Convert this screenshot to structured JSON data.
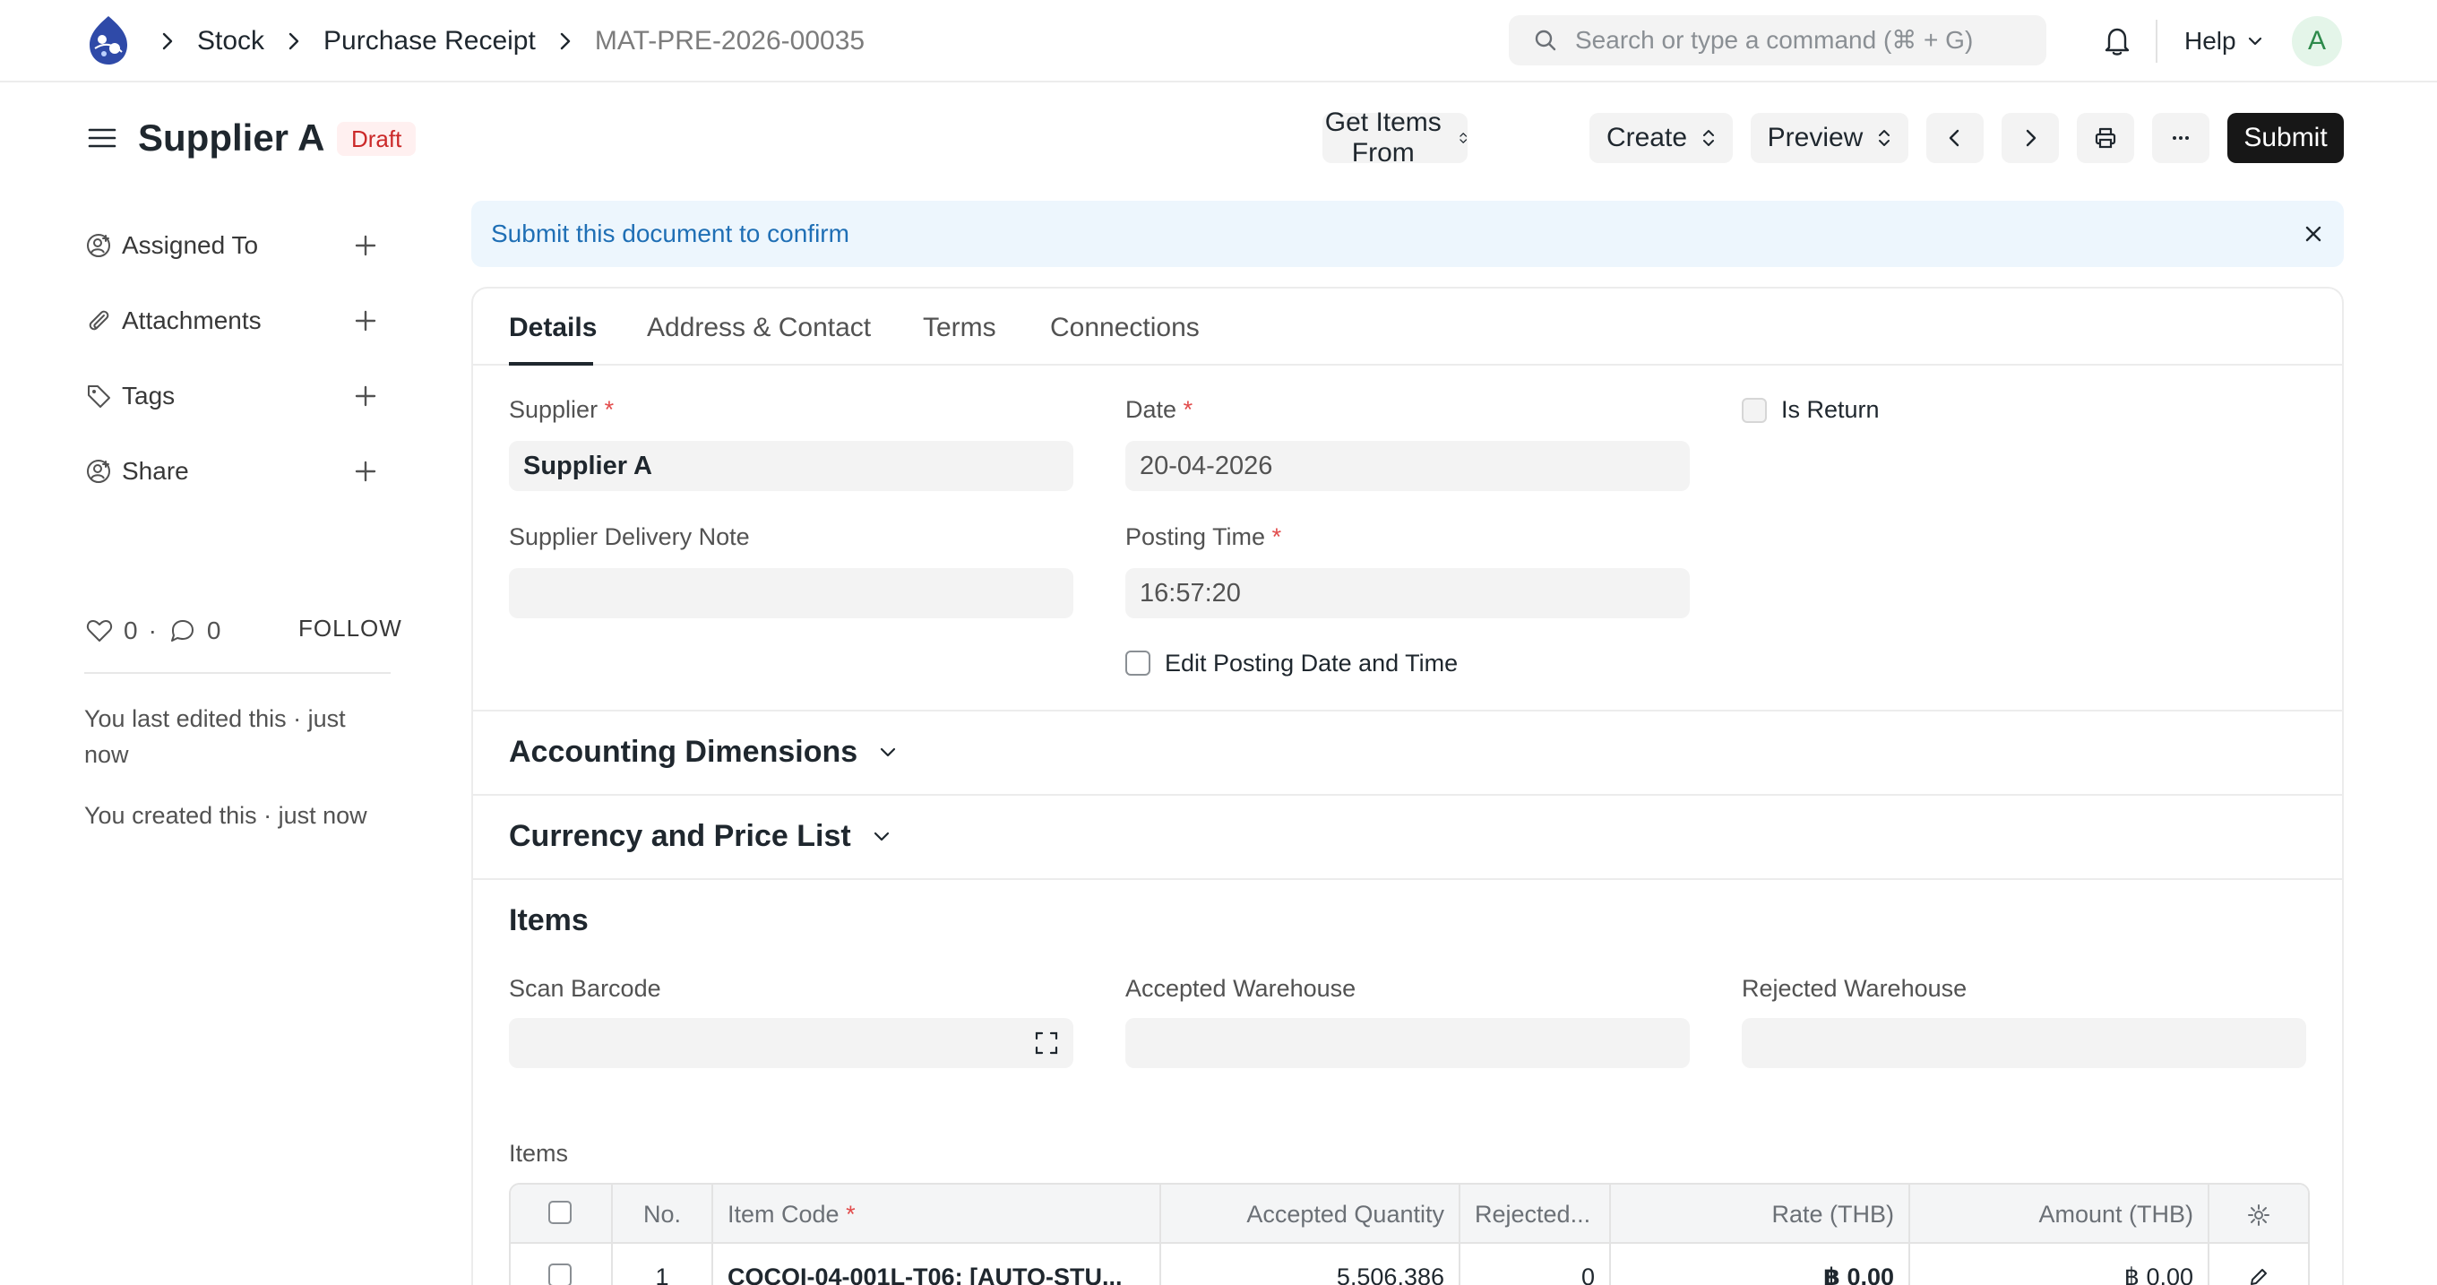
{
  "navbar": {
    "breadcrumbs": [
      "Stock",
      "Purchase Receipt",
      "MAT-PRE-2026-00035"
    ],
    "search_placeholder": "Search or type a command (⌘ + G)",
    "help_label": "Help",
    "avatar_initial": "A"
  },
  "header": {
    "title": "Supplier A",
    "status": "Draft",
    "buttons": {
      "get_items_from": "Get Items From",
      "create": "Create",
      "preview": "Preview",
      "submit": "Submit"
    }
  },
  "sidebar": {
    "items": [
      {
        "label": "Assigned To",
        "icon": "assign-user-icon"
      },
      {
        "label": "Attachments",
        "icon": "paperclip-icon"
      },
      {
        "label": "Tags",
        "icon": "tag-icon"
      },
      {
        "label": "Share",
        "icon": "share-user-icon"
      }
    ],
    "likes": "0",
    "comments": "0",
    "follow": "FOLLOW",
    "activity": [
      "You last edited this · just now",
      "You created this · just now"
    ]
  },
  "alert": {
    "message": "Submit this document to confirm"
  },
  "tabs": [
    "Details",
    "Address & Contact",
    "Terms",
    "Connections"
  ],
  "form": {
    "supplier_label": "Supplier",
    "supplier_value": "Supplier A",
    "delivery_note_label": "Supplier Delivery Note",
    "delivery_note_value": "",
    "date_label": "Date",
    "date_value": "20-04-2026",
    "posting_time_label": "Posting Time",
    "posting_time_value": "16:57:20",
    "edit_posting_label": "Edit Posting Date and Time",
    "is_return_label": "Is Return"
  },
  "sections": {
    "accounting": "Accounting Dimensions",
    "currency": "Currency and Price List",
    "items": "Items"
  },
  "items_section": {
    "scan_barcode_label": "Scan Barcode",
    "accepted_wh_label": "Accepted Warehouse",
    "rejected_wh_label": "Rejected Warehouse",
    "table_label": "Items"
  },
  "items_table": {
    "columns": [
      "No.",
      "Item Code",
      "Accepted Quantity",
      "Rejected...",
      "Rate (THB)",
      "Amount (THB)"
    ],
    "rows": [
      {
        "no": "1",
        "item_code": "COCOI-04-001L-T06: [AUTO-STU...",
        "accepted_qty": "5,506.386",
        "rejected_qty": "0",
        "rate": "฿ 0.00",
        "amount": "฿ 0.00"
      }
    ]
  },
  "colors": {
    "accent": "#171717",
    "draft_text": "#cb2929",
    "draft_bg": "#fff0f0",
    "alert_bg": "#edf6fd",
    "alert_text": "#1f6fb5"
  }
}
